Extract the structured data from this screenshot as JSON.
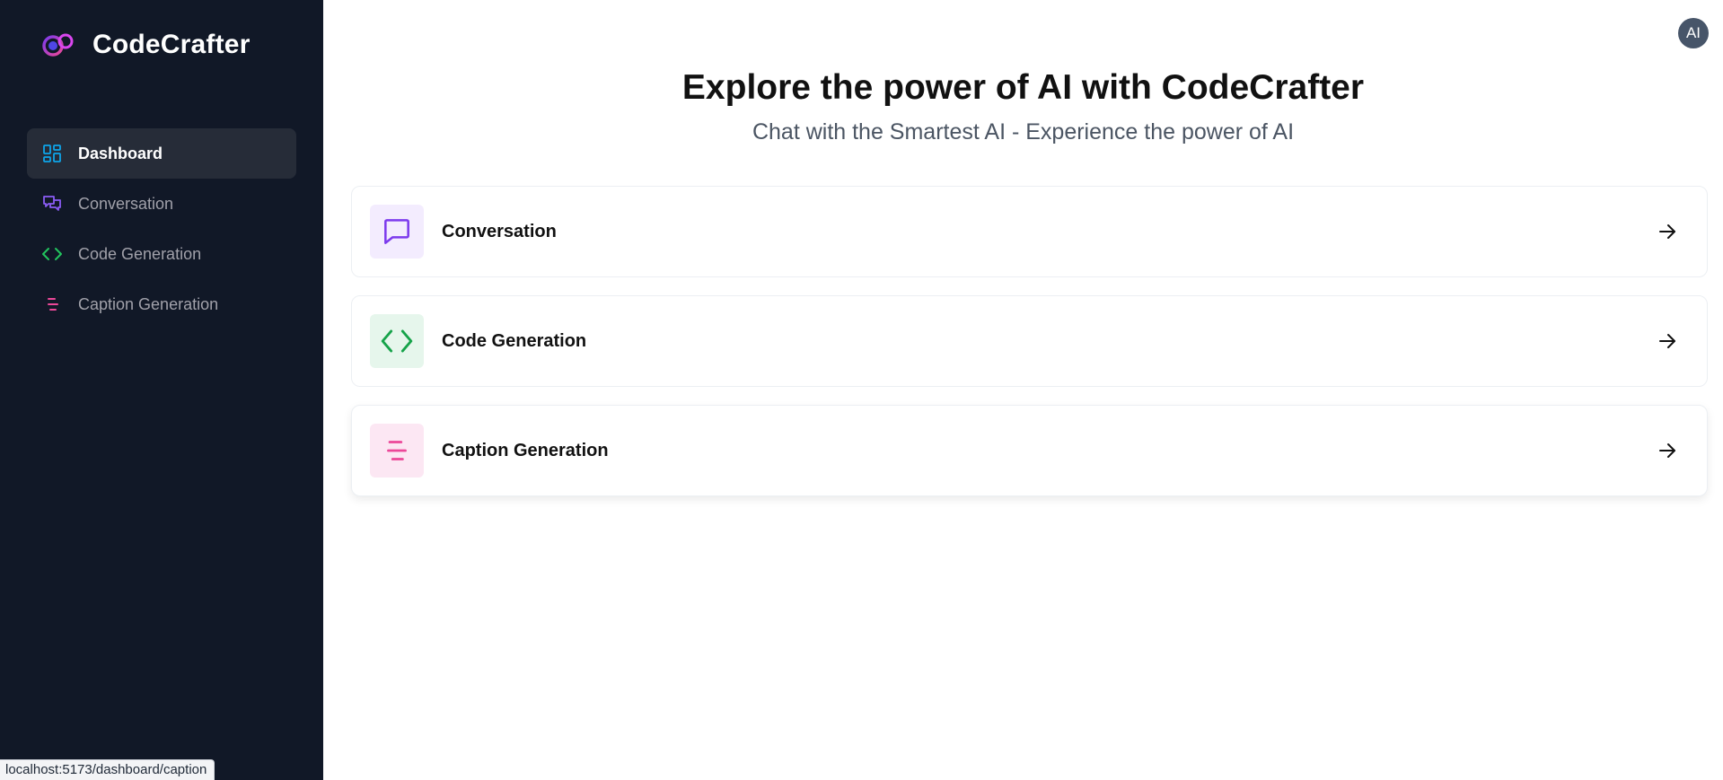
{
  "app": {
    "name": "CodeCrafter"
  },
  "sidebar": {
    "items": [
      {
        "label": "Dashboard",
        "icon": "dashboard-icon",
        "active": true,
        "color": "#0ea5e9"
      },
      {
        "label": "Conversation",
        "icon": "chat-icon",
        "active": false,
        "color": "#8b5cf6"
      },
      {
        "label": "Code Generation",
        "icon": "code-icon",
        "active": false,
        "color": "#22c55e"
      },
      {
        "label": "Caption Generation",
        "icon": "caption-icon",
        "active": false,
        "color": "#ec4899"
      }
    ]
  },
  "header": {
    "avatar_text": "AI"
  },
  "hero": {
    "title": "Explore the power of AI with CodeCrafter",
    "subtitle": "Chat with the Smartest AI - Experience the power of AI"
  },
  "cards": [
    {
      "label": "Conversation",
      "icon": "chat-icon",
      "color": "#7c3aed",
      "bg": "#f3ecfe"
    },
    {
      "label": "Code Generation",
      "icon": "code-icon",
      "color": "#16a34a",
      "bg": "#e6f6ec"
    },
    {
      "label": "Caption Generation",
      "icon": "caption-icon",
      "color": "#ec4899",
      "bg": "#fce7f3"
    }
  ],
  "status_bar": {
    "url": "localhost:5173/dashboard/caption"
  },
  "colors": {
    "sidebar_bg": "#111827",
    "active_item_bg": "#262c38"
  }
}
